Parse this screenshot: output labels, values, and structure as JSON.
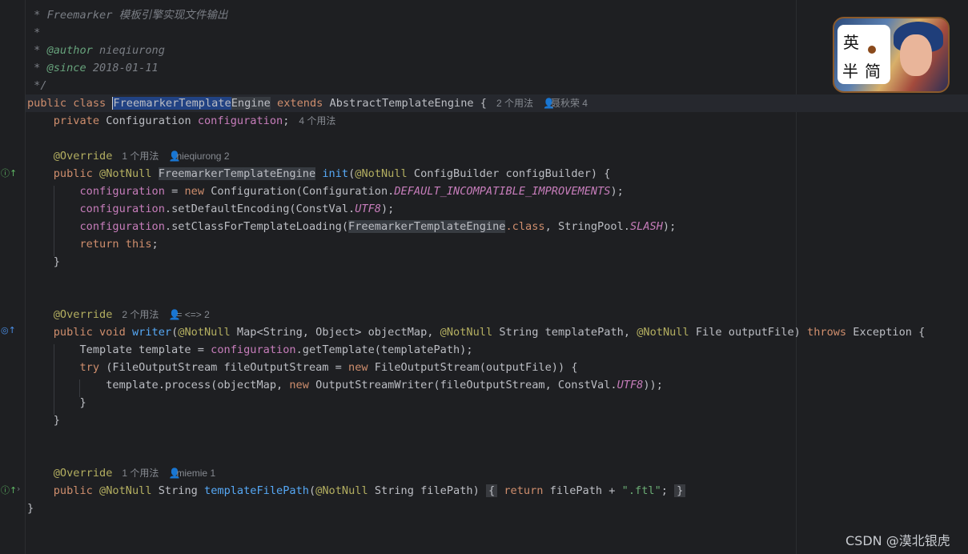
{
  "doc_comment": {
    "desc_prefix": " * ",
    "desc_text": "Freemarker 模板引擎实现文件输出",
    "empty": " *",
    "author_tag": "@author",
    "author_value": " nieqiurong",
    "since_tag": "@since",
    "since_value": " 2018-01-11",
    "close": " */"
  },
  "class_decl": {
    "modifiers": "public class ",
    "name_selected": "FreemarkerTemplate",
    "name_rest": "Engine",
    "extends_kw": " extends ",
    "parent": "AbstractTemplateEngine {",
    "usages": "2 个用法",
    "author": "聂秋荣 4"
  },
  "field_decl": {
    "indent": "    ",
    "modifier": "private ",
    "type": "Configuration ",
    "name": "configuration",
    "semi": ";",
    "usages": "4 个用法"
  },
  "init_method": {
    "override": "@Override",
    "usages": "1 个用法",
    "author": "nieqiurong 2",
    "sig_public": "public ",
    "sig_notnull": "@NotNull",
    "sig_type": "FreemarkerTemplateEngine",
    "sig_name": "init",
    "sig_param_ann": "@NotNull",
    "sig_rest": " ConfigBuilder configBuilder) {",
    "l1_field": "configuration",
    "l1_mid": " = ",
    "l1_new": "new",
    "l1_rest": " Configuration(Configuration.",
    "l1_const": "DEFAULT_INCOMPATIBLE_IMPROVEMENTS",
    "l1_end": ");",
    "l2_field": "configuration",
    "l2_rest": ".setDefaultEncoding(ConstVal.",
    "l2_const": "UTF8",
    "l2_end": ");",
    "l3_field": "configuration",
    "l3_rest": ".setClassForTemplateLoading(",
    "l3_cls": "FreemarkerTemplateEngine",
    "l3_kw": ".class",
    "l3_mid": ", StringPool.",
    "l3_const": "SLASH",
    "l3_end": ");",
    "l4_return": "return",
    "l4_this": " this",
    "l4_end": ";",
    "close": "}"
  },
  "writer_method": {
    "override": "@Override",
    "usages": "2 个用法",
    "author": "= <=> 2",
    "sig_public": "public void ",
    "sig_name": "writer",
    "sig_ann1": "@NotNull",
    "sig_p1": " Map<String, Object> objectMap, ",
    "sig_ann2": "@NotNull",
    "sig_p2": " String templatePath, ",
    "sig_ann3": "@NotNull",
    "sig_p3": " File outputFile) ",
    "sig_throws": "throws",
    "sig_exc": " Exception {",
    "l1_a": "Template template = ",
    "l1_field": "configuration",
    "l1_rest": ".getTemplate(templatePath);",
    "l2_try": "try",
    "l2_a": " (FileOutputStream fileOutputStream = ",
    "l2_new": "new",
    "l2_rest": " FileOutputStream(outputFile)) {",
    "l3_a": "template.process(objectMap, ",
    "l3_new": "new",
    "l3_rest": " OutputStreamWriter(fileOutputStream, ConstVal.",
    "l3_const": "UTF8",
    "l3_end": "));",
    "inner_close": "}",
    "close": "}"
  },
  "path_method": {
    "override": "@Override",
    "usages": "1 个用法",
    "author": "miemie 1",
    "sig_public": "public ",
    "sig_notnull": "@NotNull",
    "sig_type": " String ",
    "sig_name": "templateFilePath",
    "sig_param_ann": "@NotNull",
    "sig_rest": " String filePath)",
    "body_open": "{",
    "body_return": "return",
    "body_mid": " filePath + ",
    "body_str": "\".ftl\"",
    "body_semi": ";",
    "body_close": "}"
  },
  "class_close": "}",
  "gutter_icons": [
    "implements-icon",
    "overrides-icon",
    "implements-icon"
  ],
  "overlay": {
    "badge_chars": [
      "英",
      "半",
      "简"
    ],
    "watermark": "CSDN @漠北银虎"
  },
  "colors": {
    "background": "#1e1f22",
    "keyword": "#cf8e6d",
    "annotation": "#b3ae60",
    "field": "#c77dbb",
    "function": "#56a8f5",
    "string": "#6aab73",
    "comment": "#7a7e85"
  }
}
